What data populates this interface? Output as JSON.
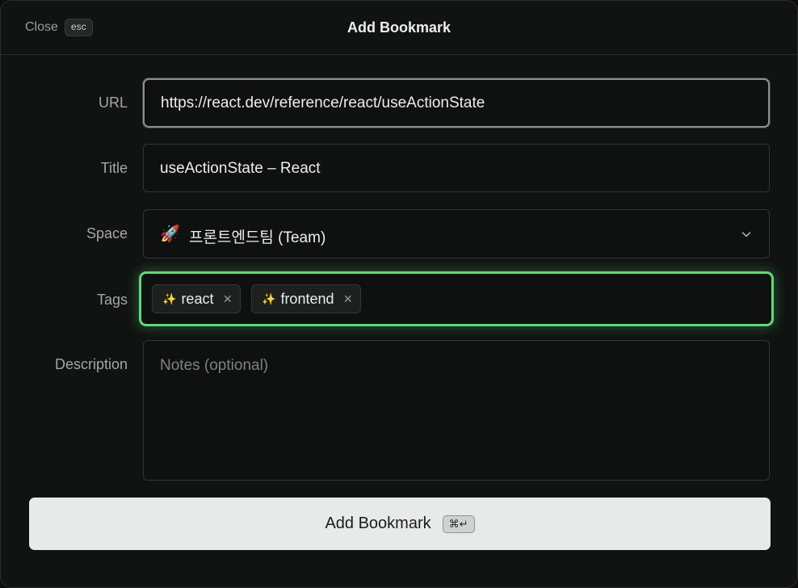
{
  "header": {
    "close_label": "Close",
    "close_shortcut": "esc",
    "title": "Add Bookmark"
  },
  "form": {
    "url": {
      "label": "URL",
      "value": "https://react.dev/reference/react/useActionState"
    },
    "title": {
      "label": "Title",
      "value": "useActionState – React"
    },
    "space": {
      "label": "Space",
      "icon": "rocket-icon",
      "emoji": "🚀",
      "value": "프론트엔드팀 (Team)"
    },
    "tags": {
      "label": "Tags",
      "focus_color": "#5fd77a",
      "items": [
        {
          "emoji": "✨",
          "label": "react"
        },
        {
          "emoji": "✨",
          "label": "frontend"
        }
      ],
      "remove_glyph": "×"
    },
    "description": {
      "label": "Description",
      "placeholder": "Notes (optional)",
      "value": ""
    }
  },
  "submit": {
    "label": "Add Bookmark",
    "shortcut": "⌘↵"
  }
}
